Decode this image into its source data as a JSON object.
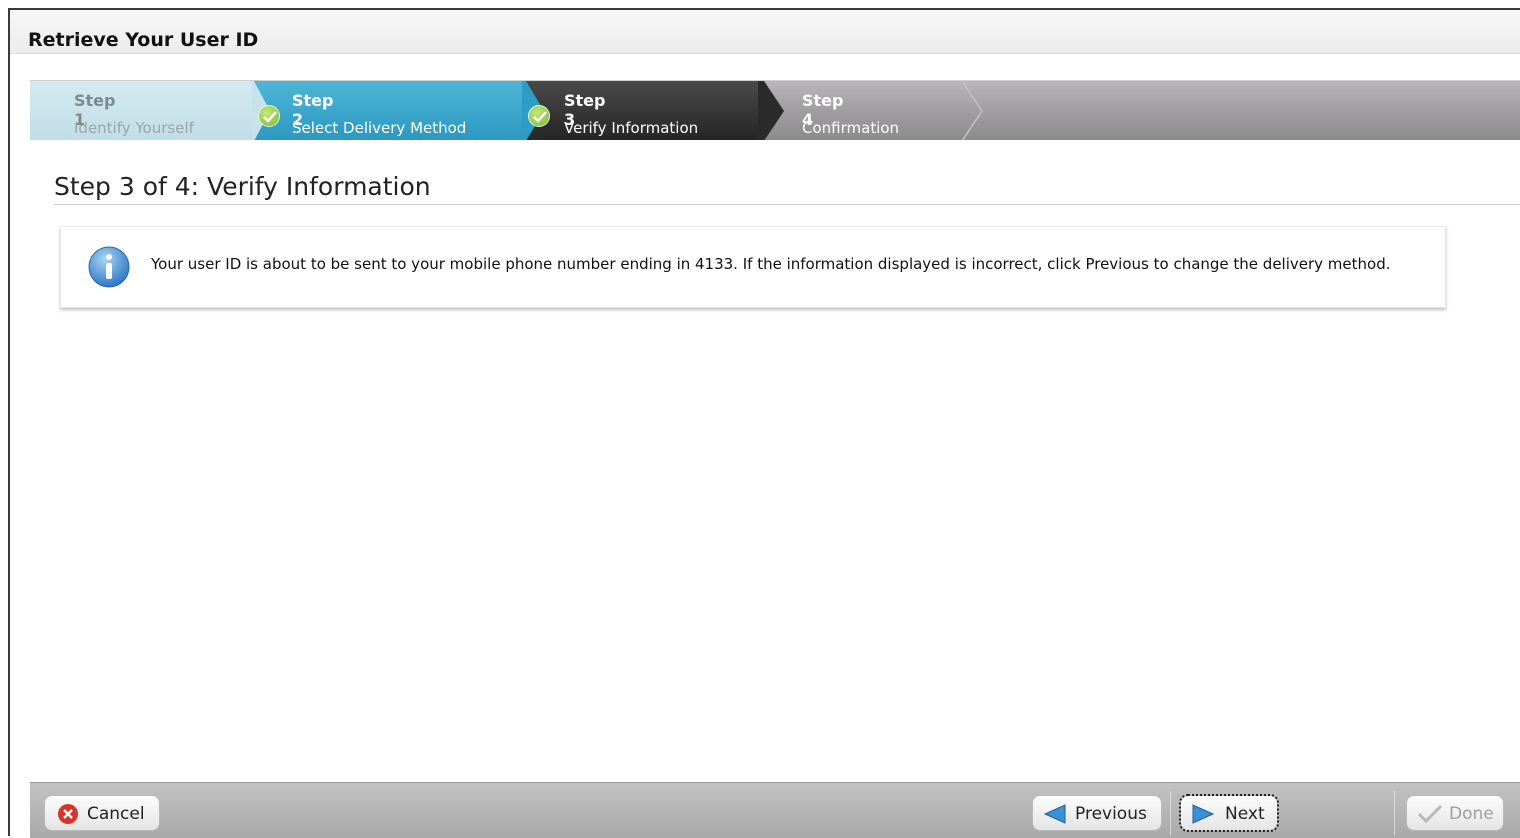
{
  "window": {
    "title": "Retrieve Your User ID"
  },
  "wizard": {
    "steps": [
      {
        "number_label": "Step 1",
        "name": "Identify Yourself",
        "state": "completed"
      },
      {
        "number_label": "Step 2",
        "name": "Select Delivery Method",
        "state": "completed"
      },
      {
        "number_label": "Step 3",
        "name": "Verify Information",
        "state": "current"
      },
      {
        "number_label": "Step 4",
        "name": "Confirmation",
        "state": "pending"
      }
    ]
  },
  "main": {
    "heading": "Step 3 of 4: Verify Information",
    "info_icon": "info-icon",
    "info_message": "Your user ID is about to be sent to your mobile phone number ending in 4133. If the information displayed is incorrect, click Previous to change the delivery method."
  },
  "footer": {
    "cancel_label": "Cancel",
    "cancel_icon": "cancel-icon",
    "previous_label": "Previous",
    "previous_icon": "arrow-left-icon",
    "next_label": "Next",
    "next_icon": "arrow-right-icon",
    "done_label": "Done",
    "done_icon": "checkmark-icon"
  },
  "colors": {
    "step_current": "#2f2f2f",
    "step_completed_active": "#34a2c8",
    "step_completed_faded": "#cbe3ec",
    "step_pending": "#9e9b9e",
    "check_green": "#7ab83a",
    "cancel_red": "#d9342b",
    "arrow_blue": "#3b8fd6"
  }
}
